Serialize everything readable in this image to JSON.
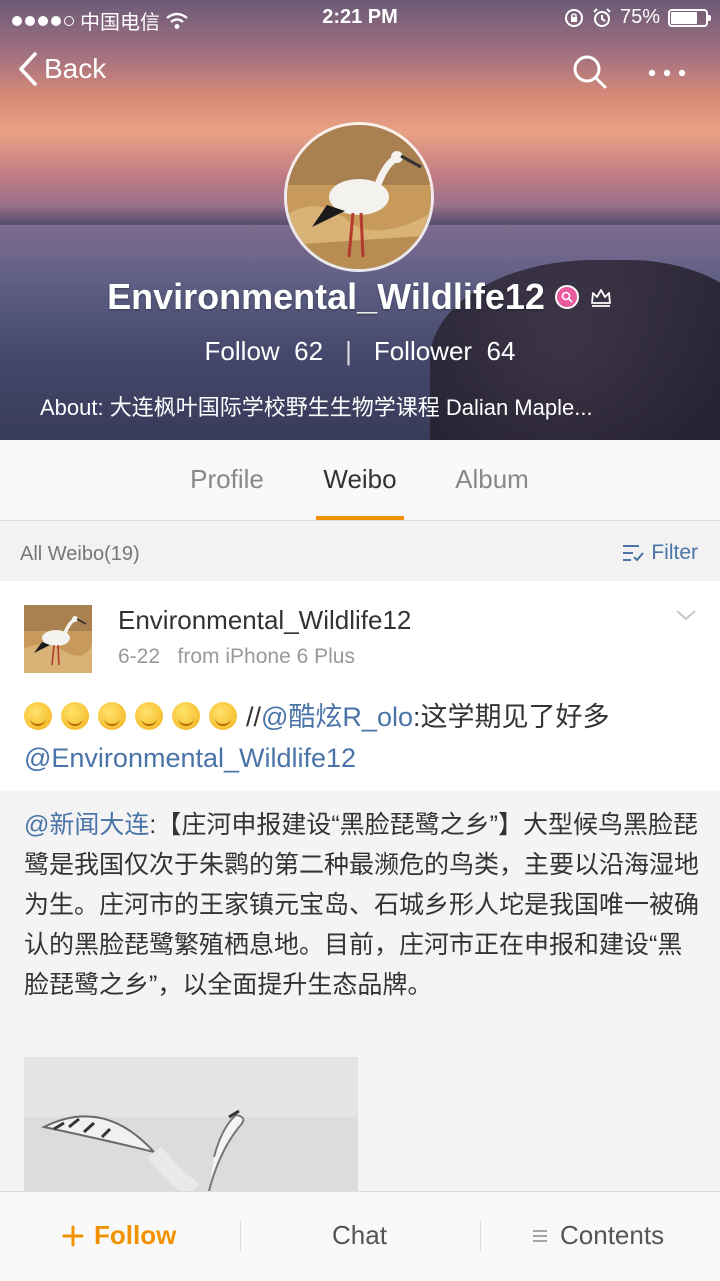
{
  "status_bar": {
    "carrier": "中国电信",
    "time": "2:21 PM",
    "battery": "75%",
    "battery_level": 0.75
  },
  "nav": {
    "back_label": "Back"
  },
  "profile": {
    "username": "Environmental_Wildlife12",
    "follow_label": "Follow",
    "follow_count": "62",
    "follower_label": "Follower",
    "follower_count": "64",
    "about": "About: 大连枫叶国际学校野生生物学课程 Dalian Maple..."
  },
  "tabs": [
    {
      "label": "Profile"
    },
    {
      "label": "Weibo"
    },
    {
      "label": "Album"
    }
  ],
  "active_tab": "Weibo",
  "filter_bar": {
    "count_label": "All Weibo(19)",
    "filter_label": "Filter"
  },
  "post": {
    "author": "Environmental_Wildlife12",
    "date": "6-22",
    "source": "from  iPhone 6 Plus",
    "text_sep": "//",
    "mention1": "@酷炫R_olo",
    "text1": ":这学期见了好多",
    "mention2": "@Environmental_Wildlife12"
  },
  "repost": {
    "mention": "@新闻大连",
    "text": ":【庄河申报建设“黑脸琵鹭之乡”】大型候鸟黑脸琵鹭是我国仅次于朱鹮的第二种最濒危的鸟类，主要以沿海湿地为生。庄河市的王家镇元宝岛、石城乡形人坨是我国唯一被确认的黑脸琵鹭繁殖栖息地。目前，庄河市正在申报和建设“黑脸琵鹭之乡”，以全面提升生态品牌。"
  },
  "bottom_bar": {
    "follow_label": "Follow",
    "chat_label": "Chat",
    "contents_label": "Contents"
  },
  "colors": {
    "accent": "#f39200",
    "link": "#4a74a8"
  }
}
